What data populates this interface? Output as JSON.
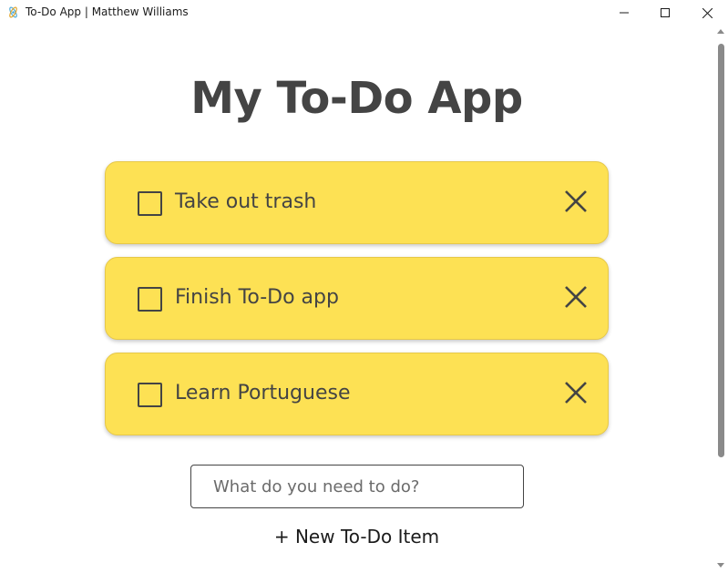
{
  "window": {
    "title": "To-Do App | Matthew Williams",
    "app_icon": "electron-icon",
    "controls": {
      "minimize": "minimize-icon",
      "maximize": "maximize-icon",
      "close": "close-icon"
    }
  },
  "page": {
    "title": "My To-Do App"
  },
  "todos": [
    {
      "label": "Take out trash",
      "done": false
    },
    {
      "label": "Finish To-Do app",
      "done": false
    },
    {
      "label": "Learn Portuguese",
      "done": false
    }
  ],
  "new_todo": {
    "value": "",
    "placeholder": "What do you need to do?"
  },
  "actions": {
    "new_item_label": "+ New To-Do Item"
  },
  "colors": {
    "card_background": "#fde154",
    "text": "#444444"
  }
}
